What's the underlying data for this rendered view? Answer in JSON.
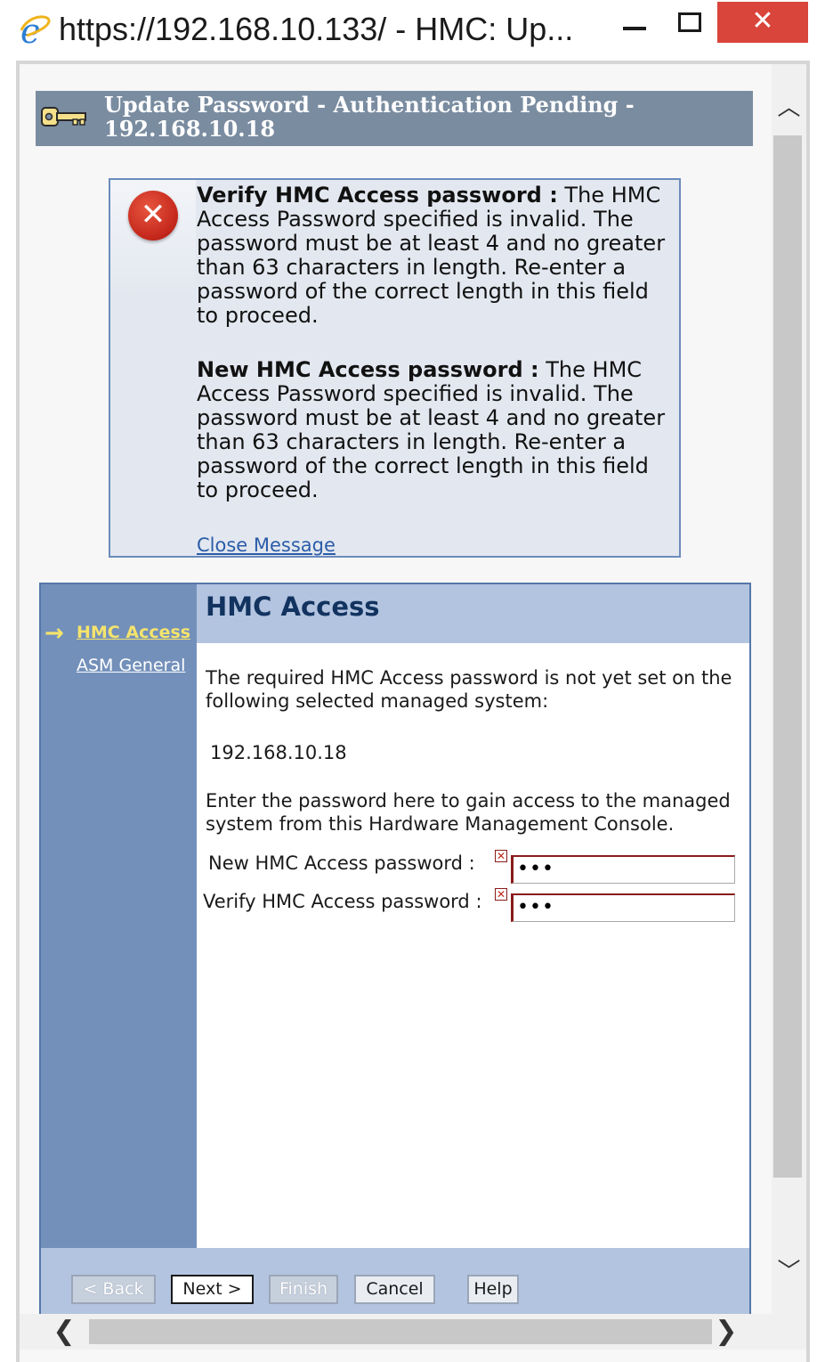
{
  "window": {
    "title": "https://192.168.10.133/ - HMC: Up...",
    "close_glyph": "✕"
  },
  "banner": {
    "title": "Update Password - Authentication Pending - 192.168.10.18",
    "icon": "key-icon"
  },
  "messages": {
    "items": [
      {
        "field": "Verify HMC Access password :",
        "text": " The HMC Access Password specified is invalid. The password must be at least 4 and no greater than 63 characters in length. Re-enter a password of the correct length in this field to proceed."
      },
      {
        "field": "New HMC Access password :",
        "text": " The HMC Access Password specified is invalid. The password must be at least 4 and no greater than 63 characters in length. Re-enter a password of the correct length in this field to proceed."
      }
    ],
    "close_label": "Close Message",
    "icon": "error-icon"
  },
  "nav": {
    "arrow": "→",
    "items": [
      {
        "label": "HMC Access",
        "current": true
      },
      {
        "label": "ASM General",
        "current": false
      }
    ]
  },
  "content": {
    "heading": "HMC Access",
    "intro": "The required HMC Access password is not yet set on the following selected managed system:",
    "system": "192.168.10.18",
    "instruction": "Enter the password here to gain access to the managed system from this Hardware Management Console.",
    "fields": [
      {
        "label": "New HMC Access password :",
        "value": "•••"
      },
      {
        "label": "Verify HMC Access password :",
        "value": "•••"
      }
    ],
    "required_marker": "✕"
  },
  "buttons": {
    "back": "< Back",
    "next": "Next >",
    "finish": "Finish",
    "cancel": "Cancel",
    "help": "Help"
  },
  "scrollbars": {
    "up": "︿",
    "down": "﹀",
    "left": "❮",
    "right": "❯"
  },
  "colors": {
    "banner": "#7a8ca0",
    "nav": "#7390ba",
    "header": "#b3c4e0",
    "message_bg": "#e3e8f0",
    "link": "#2b5ca8",
    "current_nav": "#f5e46c",
    "close_button": "#d9443b"
  }
}
